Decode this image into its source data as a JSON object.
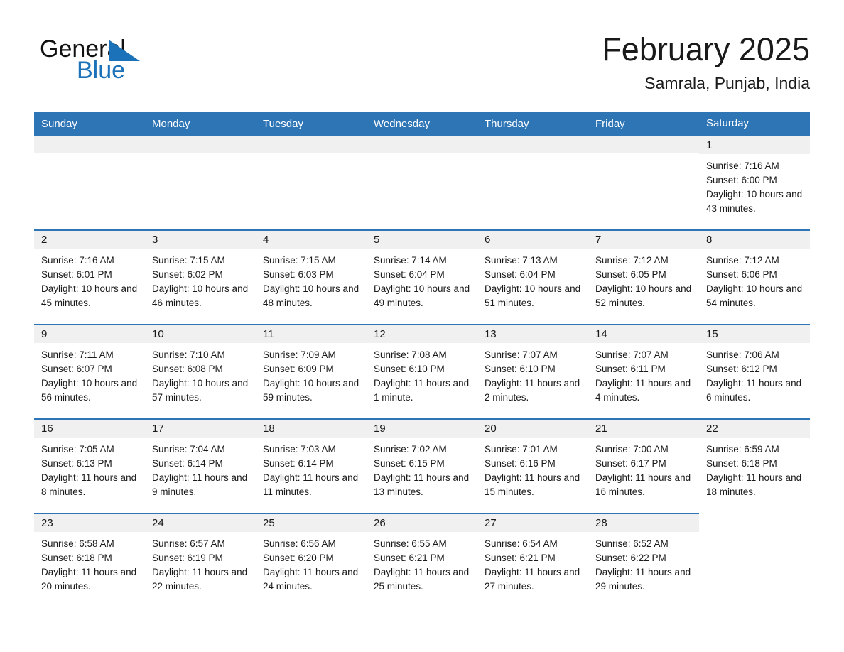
{
  "brand": {
    "name_part1": "General",
    "name_part2": "Blue",
    "triangle_color": "#1C72B8",
    "text_color": "#111111"
  },
  "header": {
    "title": "February 2025",
    "location": "Samrala, Punjab, India"
  },
  "theme": {
    "header_blue": "#2E75B6",
    "row_divider_blue": "#2E75B6",
    "daynum_band": "#f0f0f0",
    "page_background": "#ffffff",
    "text": "#1a1a1a"
  },
  "weekday_headers": [
    "Sunday",
    "Monday",
    "Tuesday",
    "Wednesday",
    "Thursday",
    "Friday",
    "Saturday"
  ],
  "weeks": [
    [
      {
        "day": "",
        "sunrise": "",
        "sunset": "",
        "daylight": "",
        "empty": true
      },
      {
        "day": "",
        "sunrise": "",
        "sunset": "",
        "daylight": "",
        "empty": true
      },
      {
        "day": "",
        "sunrise": "",
        "sunset": "",
        "daylight": "",
        "empty": true
      },
      {
        "day": "",
        "sunrise": "",
        "sunset": "",
        "daylight": "",
        "empty": true
      },
      {
        "day": "",
        "sunrise": "",
        "sunset": "",
        "daylight": "",
        "empty": true
      },
      {
        "day": "",
        "sunrise": "",
        "sunset": "",
        "daylight": "",
        "empty": true
      },
      {
        "day": "1",
        "sunrise": "Sunrise: 7:16 AM",
        "sunset": "Sunset: 6:00 PM",
        "daylight": "Daylight: 10 hours and 43 minutes.",
        "empty": false
      }
    ],
    [
      {
        "day": "2",
        "sunrise": "Sunrise: 7:16 AM",
        "sunset": "Sunset: 6:01 PM",
        "daylight": "Daylight: 10 hours and 45 minutes.",
        "empty": false
      },
      {
        "day": "3",
        "sunrise": "Sunrise: 7:15 AM",
        "sunset": "Sunset: 6:02 PM",
        "daylight": "Daylight: 10 hours and 46 minutes.",
        "empty": false
      },
      {
        "day": "4",
        "sunrise": "Sunrise: 7:15 AM",
        "sunset": "Sunset: 6:03 PM",
        "daylight": "Daylight: 10 hours and 48 minutes.",
        "empty": false
      },
      {
        "day": "5",
        "sunrise": "Sunrise: 7:14 AM",
        "sunset": "Sunset: 6:04 PM",
        "daylight": "Daylight: 10 hours and 49 minutes.",
        "empty": false
      },
      {
        "day": "6",
        "sunrise": "Sunrise: 7:13 AM",
        "sunset": "Sunset: 6:04 PM",
        "daylight": "Daylight: 10 hours and 51 minutes.",
        "empty": false
      },
      {
        "day": "7",
        "sunrise": "Sunrise: 7:12 AM",
        "sunset": "Sunset: 6:05 PM",
        "daylight": "Daylight: 10 hours and 52 minutes.",
        "empty": false
      },
      {
        "day": "8",
        "sunrise": "Sunrise: 7:12 AM",
        "sunset": "Sunset: 6:06 PM",
        "daylight": "Daylight: 10 hours and 54 minutes.",
        "empty": false
      }
    ],
    [
      {
        "day": "9",
        "sunrise": "Sunrise: 7:11 AM",
        "sunset": "Sunset: 6:07 PM",
        "daylight": "Daylight: 10 hours and 56 minutes.",
        "empty": false
      },
      {
        "day": "10",
        "sunrise": "Sunrise: 7:10 AM",
        "sunset": "Sunset: 6:08 PM",
        "daylight": "Daylight: 10 hours and 57 minutes.",
        "empty": false
      },
      {
        "day": "11",
        "sunrise": "Sunrise: 7:09 AM",
        "sunset": "Sunset: 6:09 PM",
        "daylight": "Daylight: 10 hours and 59 minutes.",
        "empty": false
      },
      {
        "day": "12",
        "sunrise": "Sunrise: 7:08 AM",
        "sunset": "Sunset: 6:10 PM",
        "daylight": "Daylight: 11 hours and 1 minute.",
        "empty": false
      },
      {
        "day": "13",
        "sunrise": "Sunrise: 7:07 AM",
        "sunset": "Sunset: 6:10 PM",
        "daylight": "Daylight: 11 hours and 2 minutes.",
        "empty": false
      },
      {
        "day": "14",
        "sunrise": "Sunrise: 7:07 AM",
        "sunset": "Sunset: 6:11 PM",
        "daylight": "Daylight: 11 hours and 4 minutes.",
        "empty": false
      },
      {
        "day": "15",
        "sunrise": "Sunrise: 7:06 AM",
        "sunset": "Sunset: 6:12 PM",
        "daylight": "Daylight: 11 hours and 6 minutes.",
        "empty": false
      }
    ],
    [
      {
        "day": "16",
        "sunrise": "Sunrise: 7:05 AM",
        "sunset": "Sunset: 6:13 PM",
        "daylight": "Daylight: 11 hours and 8 minutes.",
        "empty": false
      },
      {
        "day": "17",
        "sunrise": "Sunrise: 7:04 AM",
        "sunset": "Sunset: 6:14 PM",
        "daylight": "Daylight: 11 hours and 9 minutes.",
        "empty": false
      },
      {
        "day": "18",
        "sunrise": "Sunrise: 7:03 AM",
        "sunset": "Sunset: 6:14 PM",
        "daylight": "Daylight: 11 hours and 11 minutes.",
        "empty": false
      },
      {
        "day": "19",
        "sunrise": "Sunrise: 7:02 AM",
        "sunset": "Sunset: 6:15 PM",
        "daylight": "Daylight: 11 hours and 13 minutes.",
        "empty": false
      },
      {
        "day": "20",
        "sunrise": "Sunrise: 7:01 AM",
        "sunset": "Sunset: 6:16 PM",
        "daylight": "Daylight: 11 hours and 15 minutes.",
        "empty": false
      },
      {
        "day": "21",
        "sunrise": "Sunrise: 7:00 AM",
        "sunset": "Sunset: 6:17 PM",
        "daylight": "Daylight: 11 hours and 16 minutes.",
        "empty": false
      },
      {
        "day": "22",
        "sunrise": "Sunrise: 6:59 AM",
        "sunset": "Sunset: 6:18 PM",
        "daylight": "Daylight: 11 hours and 18 minutes.",
        "empty": false
      }
    ],
    [
      {
        "day": "23",
        "sunrise": "Sunrise: 6:58 AM",
        "sunset": "Sunset: 6:18 PM",
        "daylight": "Daylight: 11 hours and 20 minutes.",
        "empty": false
      },
      {
        "day": "24",
        "sunrise": "Sunrise: 6:57 AM",
        "sunset": "Sunset: 6:19 PM",
        "daylight": "Daylight: 11 hours and 22 minutes.",
        "empty": false
      },
      {
        "day": "25",
        "sunrise": "Sunrise: 6:56 AM",
        "sunset": "Sunset: 6:20 PM",
        "daylight": "Daylight: 11 hours and 24 minutes.",
        "empty": false
      },
      {
        "day": "26",
        "sunrise": "Sunrise: 6:55 AM",
        "sunset": "Sunset: 6:21 PM",
        "daylight": "Daylight: 11 hours and 25 minutes.",
        "empty": false
      },
      {
        "day": "27",
        "sunrise": "Sunrise: 6:54 AM",
        "sunset": "Sunset: 6:21 PM",
        "daylight": "Daylight: 11 hours and 27 minutes.",
        "empty": false
      },
      {
        "day": "28",
        "sunrise": "Sunrise: 6:52 AM",
        "sunset": "Sunset: 6:22 PM",
        "daylight": "Daylight: 11 hours and 29 minutes.",
        "empty": false
      },
      {
        "day": "",
        "sunrise": "",
        "sunset": "",
        "daylight": "",
        "empty": true
      }
    ]
  ]
}
